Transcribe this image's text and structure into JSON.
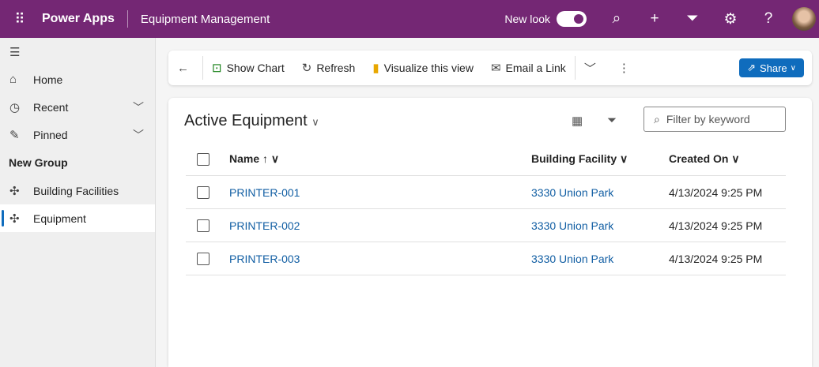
{
  "topbar": {
    "brand": "Power Apps",
    "app_name": "Equipment Management",
    "new_look": "New look",
    "new_look_on": true
  },
  "sidebar": {
    "items": [
      {
        "label": "Home"
      },
      {
        "label": "Recent"
      },
      {
        "label": "Pinned"
      }
    ],
    "group": "New Group",
    "group_items": [
      {
        "label": "Building Facilities"
      },
      {
        "label": "Equipment"
      }
    ]
  },
  "commands": {
    "show_chart": "Show Chart",
    "refresh": "Refresh",
    "visualize": "Visualize this view",
    "email": "Email a Link",
    "share": "Share"
  },
  "view": {
    "title": "Active Equipment",
    "filter_placeholder": "Filter by keyword",
    "columns": [
      "Name",
      "Building Facility",
      "Created On"
    ],
    "rows": [
      {
        "name": "PRINTER-001",
        "facility": "3330 Union Park",
        "created": "4/13/2024 9:25 PM"
      },
      {
        "name": "PRINTER-002",
        "facility": "3330 Union Park",
        "created": "4/13/2024 9:25 PM"
      },
      {
        "name": "PRINTER-003",
        "facility": "3330 Union Park",
        "created": "4/13/2024 9:25 PM"
      }
    ]
  },
  "colors": {
    "header": "#742774",
    "accent": "#0f6cbd",
    "link": "#115ea3"
  }
}
